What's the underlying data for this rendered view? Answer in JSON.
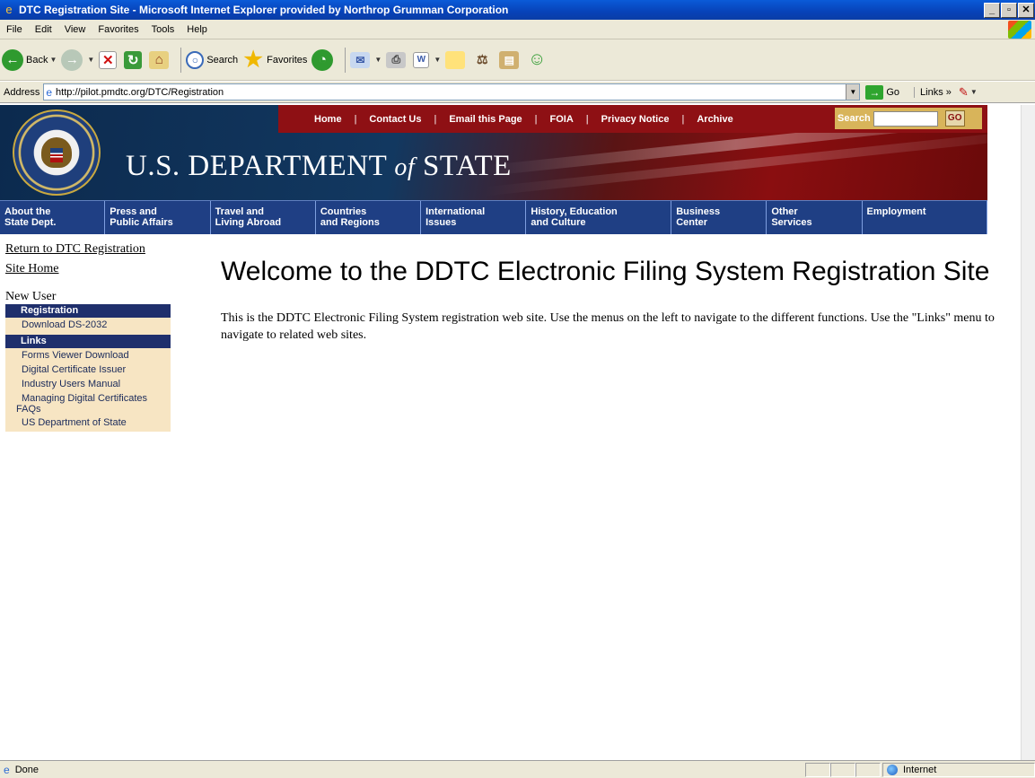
{
  "window": {
    "title": "DTC Registration Site - Microsoft Internet Explorer provided by Northrop Grumman Corporation",
    "buttons": [
      "_",
      "▫",
      "✕"
    ]
  },
  "menubar": {
    "items": [
      "File",
      "Edit",
      "View",
      "Favorites",
      "Tools",
      "Help"
    ]
  },
  "toolbar": {
    "back_label": "Back",
    "search_label": "Search",
    "favorites_label": "Favorites"
  },
  "addressbar": {
    "label": "Address",
    "url": "http://pilot.pmdtc.org/DTC/Registration",
    "go_label": "Go",
    "links_label": "Links »"
  },
  "header": {
    "site_title_part1": "U.S. DEPARTMENT ",
    "site_title_of": "of",
    "site_title_part2": " STATE",
    "utility_nav": [
      "Home",
      "Contact Us",
      "Email this Page",
      "FOIA",
      "Privacy Notice",
      "Archive"
    ],
    "search_label": "Search",
    "go_label": "GO"
  },
  "main_nav": [
    "About the\nState Dept.",
    "Press and\nPublic Affairs",
    "Travel and\nLiving Abroad",
    "Countries\nand Regions",
    "International\nIssues",
    "History, Education\nand Culture",
    "Business\nCenter",
    "Other\nServices",
    "Employment"
  ],
  "left_nav": {
    "return_link_line1": "Return to DTC Registration",
    "return_link_line2": "Site Home",
    "section_label": "New User",
    "registration_header": "Registration",
    "registration_items": [
      "Download DS-2032"
    ],
    "links_header": "Links",
    "links_items": [
      "Forms Viewer Download",
      "Digital Certificate Issuer",
      "Industry Users Manual",
      "Managing Digital Certificates FAQs",
      "US Department of State"
    ]
  },
  "content": {
    "heading": "Welcome to the DDTC Electronic Filing System Registration Site",
    "intro": "This is the DDTC Electronic Filing System registration web site. Use the menus on the left to navigate to the different functions. Use the \"Links\" menu to navigate to related web sites."
  },
  "statusbar": {
    "status": "Done",
    "zone": "Internet"
  },
  "colors": {
    "nav_blue": "#1f3f84",
    "header_red": "#8e1014",
    "left_item_bg": "#f7e5c3",
    "left_header_bg": "#1f2f6c"
  }
}
